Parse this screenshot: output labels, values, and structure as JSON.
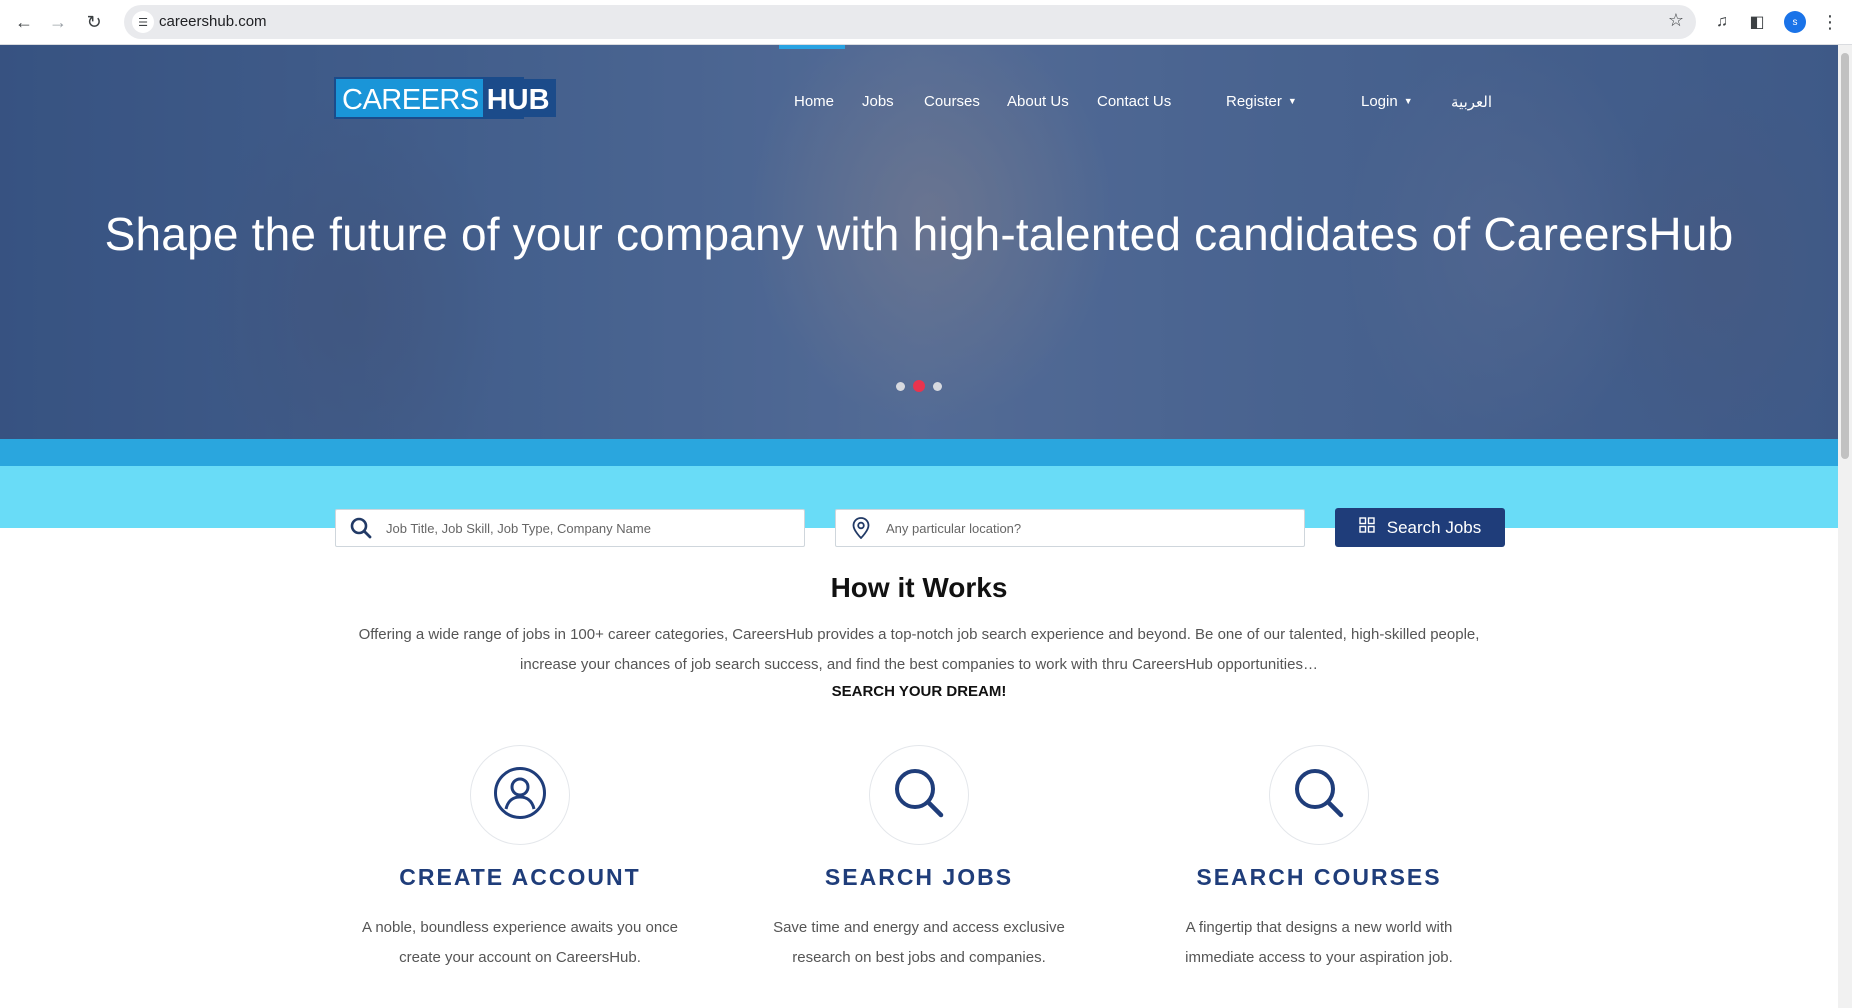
{
  "browser": {
    "url": "careershub.com",
    "profile_initial": "s"
  },
  "header": {
    "logo_left": "CAREERS",
    "logo_right": "HUB",
    "nav": [
      "Home",
      "Jobs",
      "Courses",
      "About Us",
      "Contact Us"
    ],
    "register_label": "Register",
    "login_label": "Login",
    "language_label": "العربية"
  },
  "hero": {
    "title": "Shape the future of your company with high-talented candidates of CareersHub",
    "slides": 3,
    "active_slide": 2
  },
  "search": {
    "keyword_placeholder": "Job Title, Job Skill, Job Type, Company Name",
    "location_placeholder": "Any particular location?",
    "button_label": "Search Jobs"
  },
  "how_it_works": {
    "title": "How it Works",
    "description": "Offering a wide range of jobs in 100+ career categories, CareersHub provides a top-notch job search experience and beyond. Be one of our talented, high-skilled people, increase your chances of job search success, and find the best companies to work with thru CareersHub opportunities…",
    "cta": "SEARCH YOUR DREAM!",
    "features": [
      {
        "icon": "user-icon",
        "title": "CREATE ACCOUNT",
        "text": "A noble, boundless experience awaits you once create your account on CareersHub."
      },
      {
        "icon": "search-icon",
        "title": "SEARCH JOBS",
        "text": "Save time and energy and access exclusive research on best jobs and companies."
      },
      {
        "icon": "search-icon",
        "title": "SEARCH COURSES",
        "text": "A fingertip that designs a new world with immediate access to your aspiration job."
      }
    ]
  },
  "colors": {
    "brand_dark": "#1f3d7a",
    "brand_light": "#1a95d8",
    "band": "#69dcf7",
    "band_top": "#2aa6de",
    "active_dot": "#e8344e"
  }
}
